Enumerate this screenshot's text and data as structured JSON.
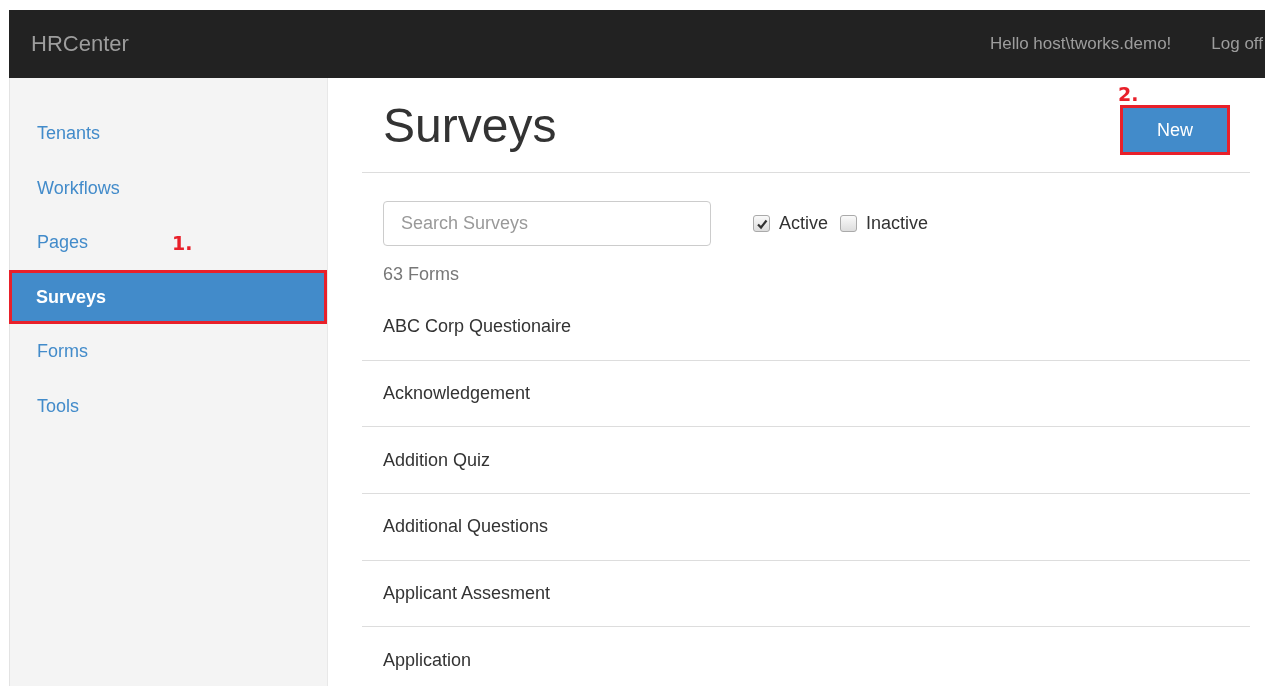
{
  "navbar": {
    "brand": "HRCenter",
    "greeting": "Hello host\\tworks.demo!",
    "logoff": "Log off"
  },
  "sidebar": {
    "items": [
      {
        "label": "Tenants",
        "selected": false,
        "highlighted": false
      },
      {
        "label": "Workflows",
        "selected": false,
        "highlighted": false
      },
      {
        "label": "Pages",
        "selected": false,
        "highlighted": false
      },
      {
        "label": "Surveys",
        "selected": true,
        "highlighted": true
      },
      {
        "label": "Forms",
        "selected": false,
        "highlighted": false
      },
      {
        "label": "Tools",
        "selected": false,
        "highlighted": false
      }
    ]
  },
  "annotations": [
    {
      "label": "1."
    },
    {
      "label": "2."
    }
  ],
  "page": {
    "title": "Surveys",
    "new_button": {
      "label": "New",
      "highlighted": true
    }
  },
  "search": {
    "placeholder": "Search Surveys"
  },
  "filters": [
    {
      "label": "Active",
      "checked": true
    },
    {
      "label": "Inactive",
      "checked": false
    }
  ],
  "count": "63 Forms",
  "forms": [
    "ABC Corp Questionaire",
    "Acknowledgement",
    "Addition Quiz",
    "Additional Questions",
    "Applicant Assesment",
    "Application"
  ]
}
